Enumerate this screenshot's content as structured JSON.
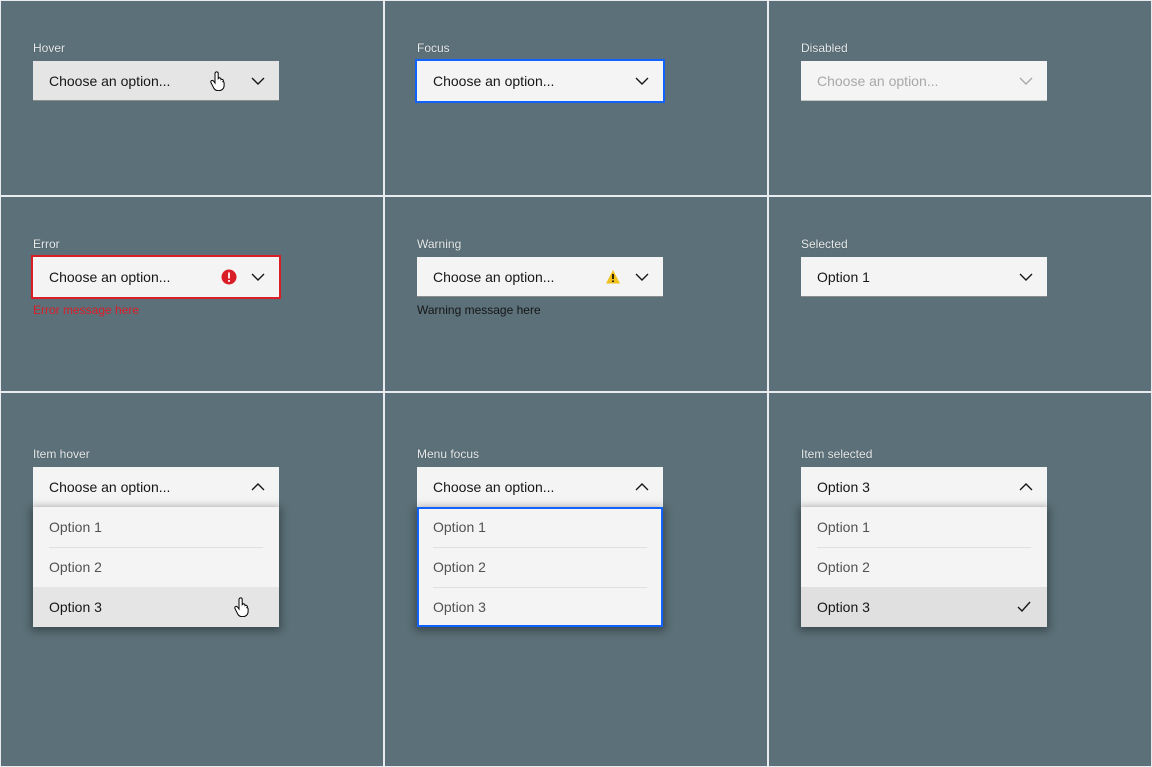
{
  "placeholder": "Choose an option...",
  "options": [
    "Option 1",
    "Option 2",
    "Option 3"
  ],
  "states": {
    "hover": {
      "label": "Hover"
    },
    "focus": {
      "label": "Focus"
    },
    "disabled": {
      "label": "Disabled"
    },
    "error": {
      "label": "Error",
      "message": "Error message here"
    },
    "warning": {
      "label": "Warning",
      "message": "Warning message here"
    },
    "selected": {
      "label": "Selected",
      "value": "Option 1"
    },
    "item_hover": {
      "label": "Item hover"
    },
    "menu_focus": {
      "label": "Menu focus"
    },
    "item_selected": {
      "label": "Item selected",
      "value": "Option 3"
    }
  },
  "colors": {
    "focus": "#0f62fe",
    "error": "#da1e28",
    "warning": "#f1c21b",
    "field_bg": "#f4f4f4",
    "hover_bg": "#e5e5e5"
  }
}
